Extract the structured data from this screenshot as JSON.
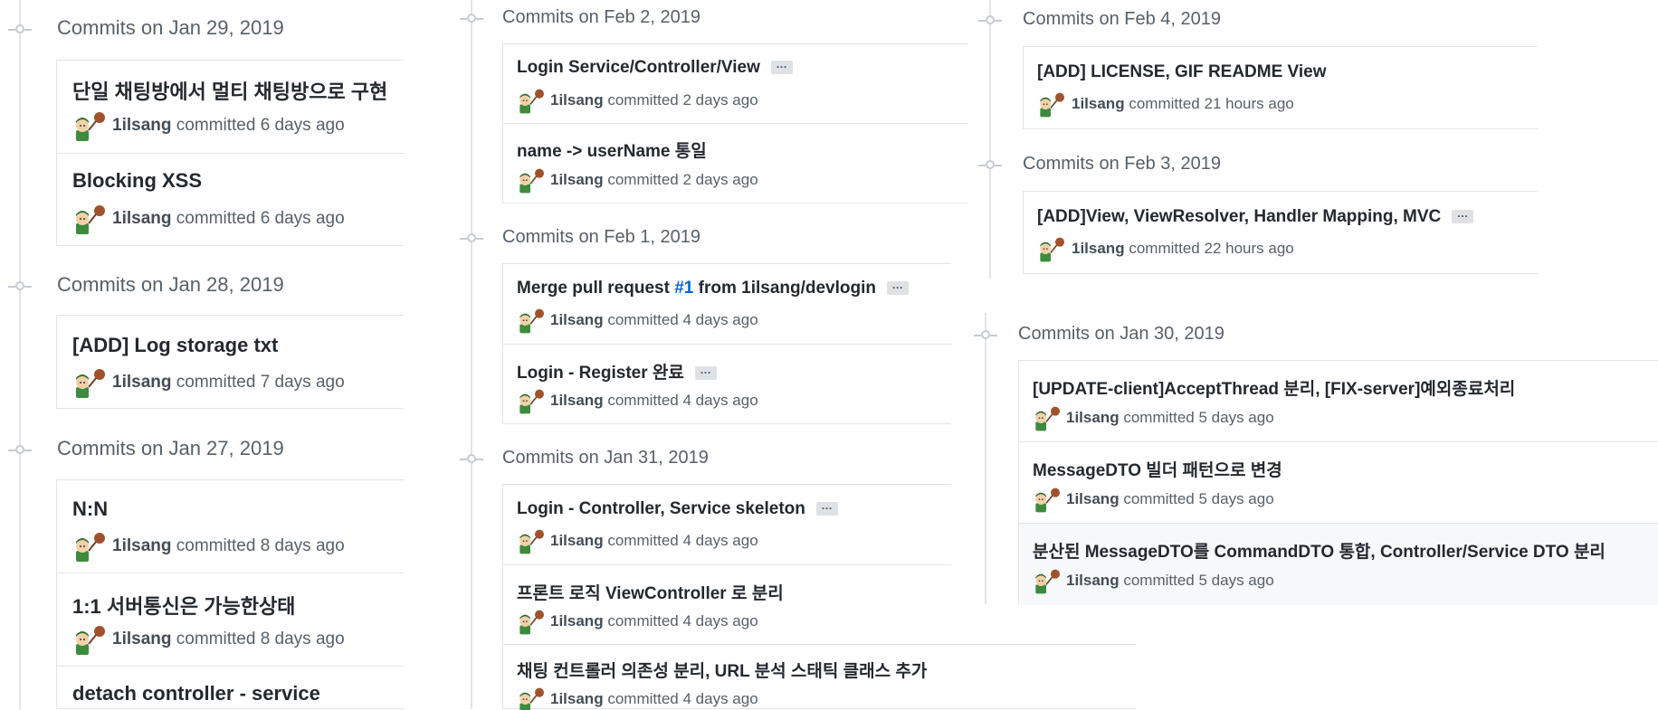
{
  "author": "1ilsang",
  "committed_word": "committed",
  "left": [
    {
      "date": "Commits on Jan 29, 2019",
      "commits": [
        {
          "message": "단일 채팅방에서 멀티 채팅방으로 구현",
          "time": "6 days ago"
        },
        {
          "message": "Blocking XSS",
          "time": "6 days ago"
        }
      ]
    },
    {
      "date": "Commits on Jan 28, 2019",
      "commits": [
        {
          "message": "[ADD] Log storage txt",
          "time": "7 days ago"
        }
      ]
    },
    {
      "date": "Commits on Jan 27, 2019",
      "commits": [
        {
          "message": "N:N",
          "time": "8 days ago"
        },
        {
          "message": "1:1 서버통신은 가능한상태",
          "time": "8 days ago"
        },
        {
          "message": "detach controller - service",
          "time": ""
        }
      ]
    }
  ],
  "middle": [
    {
      "date": "Commits on Feb 2, 2019",
      "commits": [
        {
          "message": "Login Service/Controller/View",
          "time": "2 days ago",
          "ellipsis": "···"
        },
        {
          "message": "name -> userName 통일",
          "time": "2 days ago"
        }
      ]
    },
    {
      "date": "Commits on Feb 1, 2019",
      "commits": [
        {
          "message_pre": "Merge pull request ",
          "issue": "#1",
          "message_post": " from 1ilsang/devlogin",
          "time": "4 days ago",
          "ellipsis": "···"
        },
        {
          "message": "Login - Register 완료",
          "time": "4 days ago",
          "ellipsis": "···"
        }
      ]
    },
    {
      "date": "Commits on Jan 31, 2019",
      "commits": [
        {
          "message": "Login - Controller, Service skeleton",
          "time": "4 days ago",
          "ellipsis": "···"
        },
        {
          "message": "프론트 로직 ViewController 로 분리",
          "time": "4 days ago"
        },
        {
          "message": "채팅 컨트롤러 의존성 분리, URL 분석 스태틱 클래스 추가",
          "time": "4 days ago"
        }
      ]
    }
  ],
  "right_top": [
    {
      "date": "Commits on Feb 4, 2019",
      "commits": [
        {
          "message": "[ADD] LICENSE, GIF README View",
          "time": "21 hours ago"
        }
      ]
    },
    {
      "date": "Commits on Feb 3, 2019",
      "commits": [
        {
          "message": "[ADD]View, ViewResolver, Handler Mapping, MVC",
          "time": "22 hours ago",
          "ellipsis": "···"
        }
      ]
    }
  ],
  "right_bottom": [
    {
      "date": "Commits on Jan 30, 2019",
      "commits": [
        {
          "message": "[UPDATE-client]AcceptThread 분리, [FIX-server]예외종료처리",
          "time": "5 days ago"
        },
        {
          "message": "MessageDTO 빌더 패턴으로 변경",
          "time": "5 days ago"
        },
        {
          "message": "분산된 MessageDTO를 CommandDTO 통합, Controller/Service DTO 분리",
          "time": "5 days ago"
        }
      ]
    }
  ],
  "colors": {
    "link": "#0366d6",
    "border": "#e1e4e8",
    "muted": "#586069",
    "highlight_row": "#f6f8fa"
  },
  "icons": [
    "timeline-node-icon",
    "avatar-icon"
  ]
}
